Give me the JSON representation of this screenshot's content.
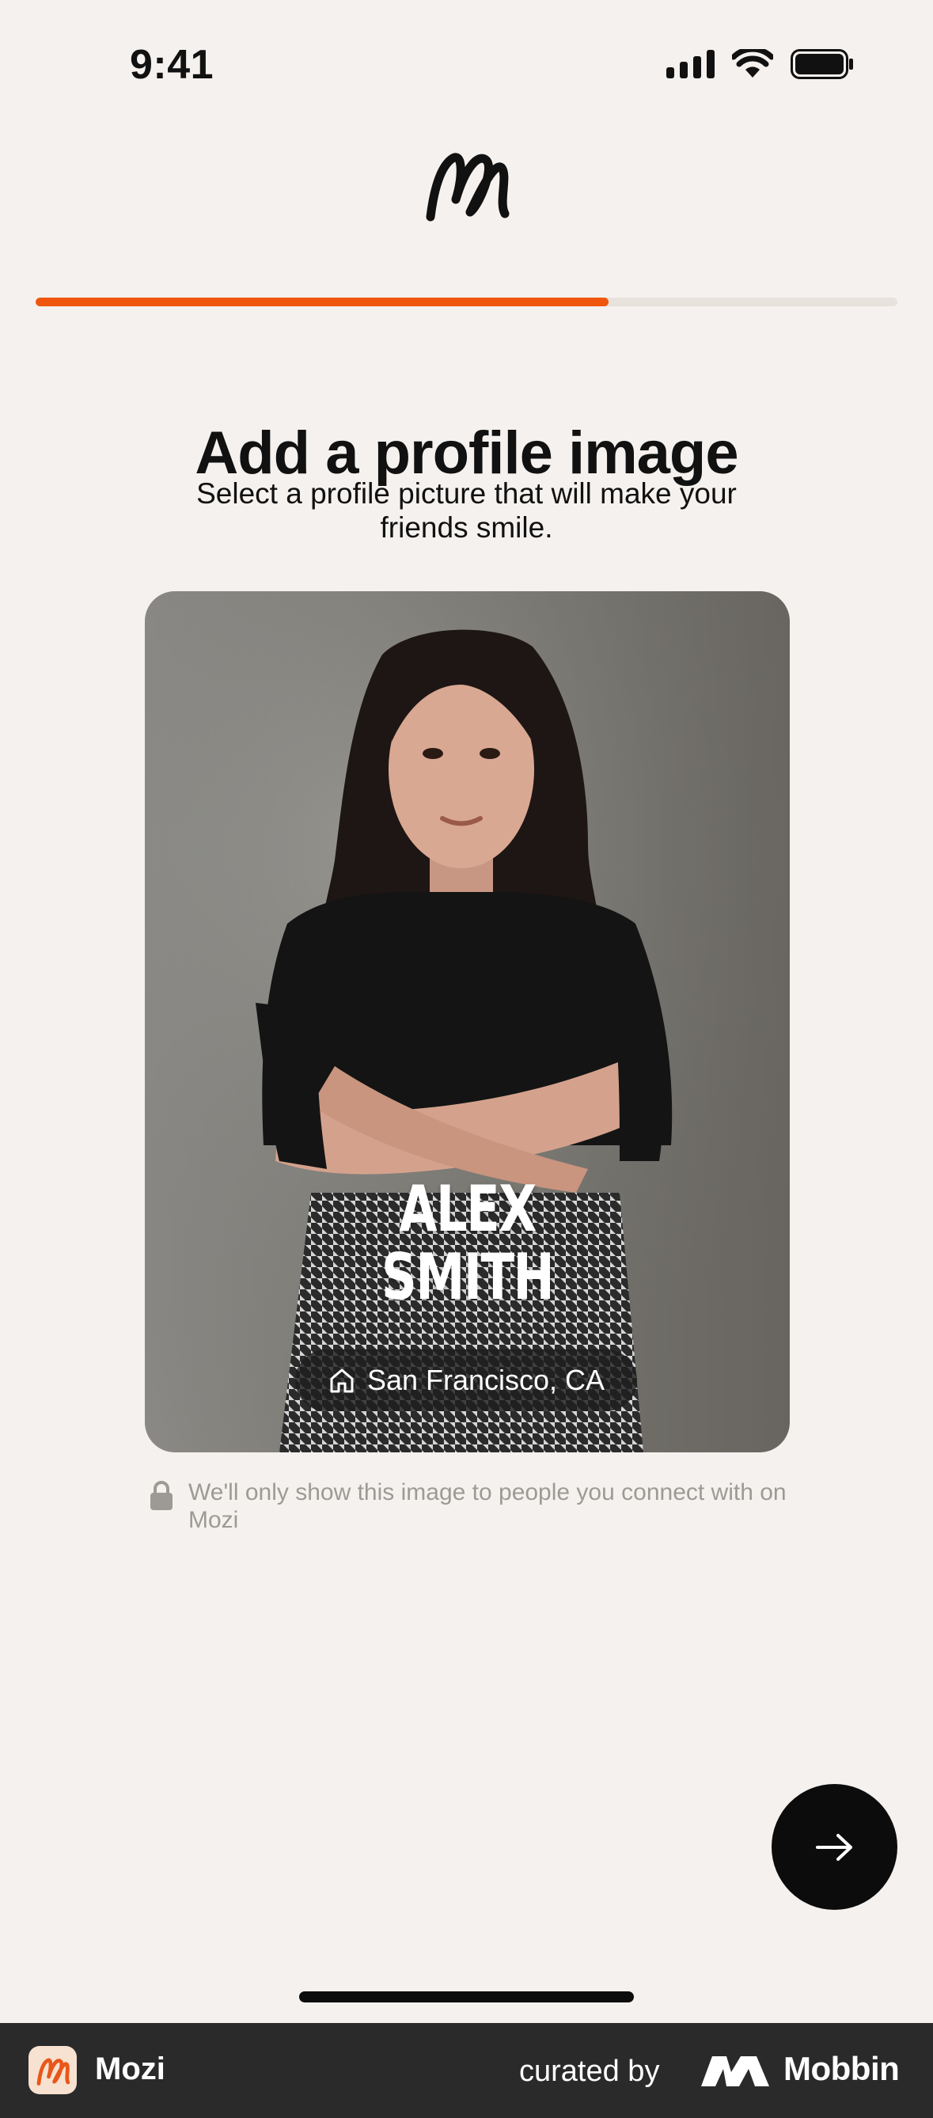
{
  "status_bar": {
    "time": "9:41",
    "icons": [
      "cellular-signal-icon",
      "wifi-icon",
      "battery-icon"
    ]
  },
  "app_logo": "mozi-logo",
  "progress": {
    "fraction": 0.665,
    "color": "#f0570e"
  },
  "title": "Add a profile image",
  "subtitle": "Select a profile picture that will make your friends smile.",
  "card": {
    "name_line1": "ALEX",
    "name_line2": "SMITH",
    "location": "San Francisco, CA",
    "location_icon": "home-icon"
  },
  "privacy_note": {
    "icon": "lock-icon",
    "text": "We'll only show this image to people you connect with on Mozi"
  },
  "next_button": {
    "icon": "arrow-right-icon"
  },
  "footer": {
    "app_name": "Mozi",
    "curated_by": "curated by",
    "brand": "Mobbin"
  },
  "colors": {
    "accent": "#f0570e",
    "background": "#f5f1ee",
    "footer": "#2a2a2b"
  }
}
